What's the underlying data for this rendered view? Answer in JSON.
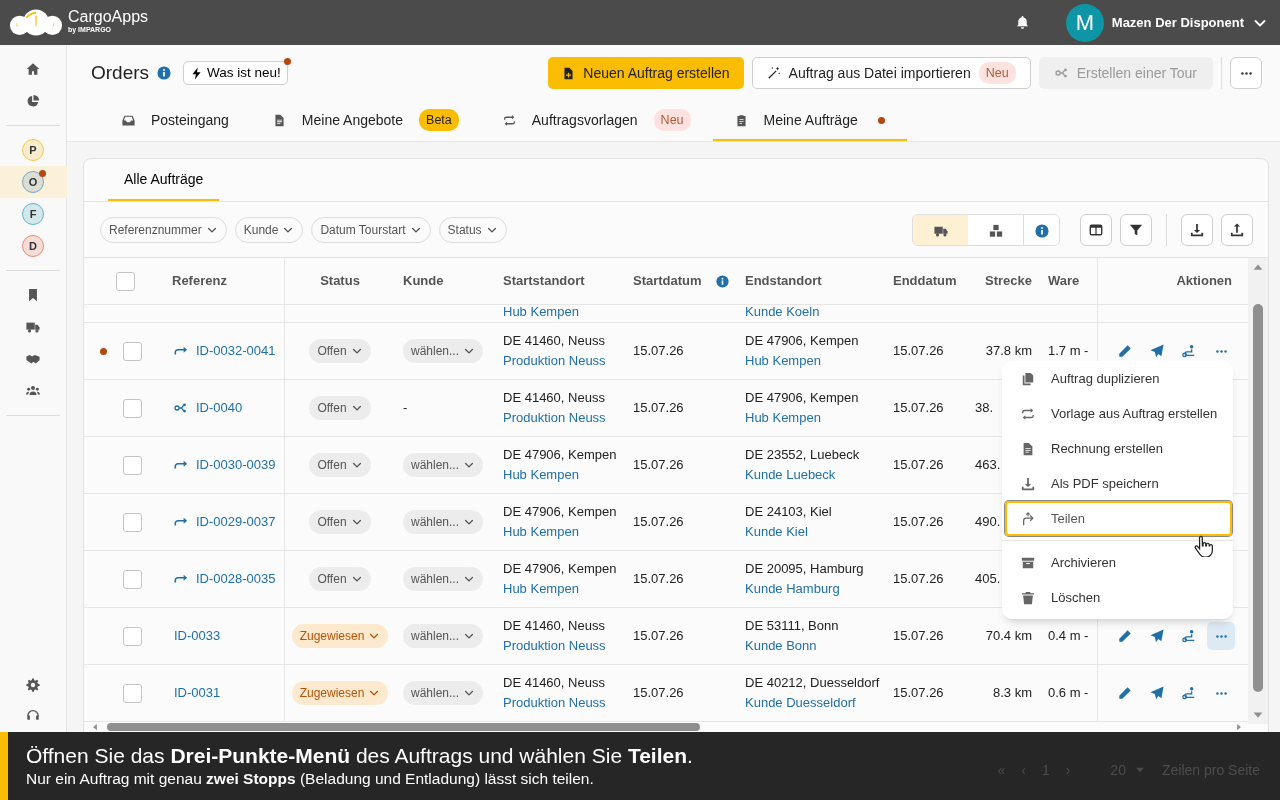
{
  "app": {
    "name": "CargoApps",
    "tagline": "by IMPARGO"
  },
  "user": {
    "initial": "M",
    "name": "Mazen Der Disponent"
  },
  "workspaces": [
    {
      "letter": "P",
      "color": "#f7c948",
      "selected": false,
      "unread": false
    },
    {
      "letter": "O",
      "color": "#7aa7c7",
      "selected": true,
      "unread": true
    },
    {
      "letter": "F",
      "color": "#5fb7c4",
      "selected": false,
      "unread": false
    },
    {
      "letter": "D",
      "color": "#e88b74",
      "selected": false,
      "unread": false
    }
  ],
  "page": {
    "title": "Orders",
    "whats_new": {
      "label": "Was ist neu!",
      "unread": true
    }
  },
  "actions": {
    "create": "Neuen Auftrag erstellen",
    "import": {
      "label": "Auftrag aus Datei importieren",
      "badge": "Neu"
    },
    "tour": {
      "label": "Erstellen einer Tour",
      "disabled": true
    }
  },
  "tabs": [
    {
      "label": "Posteingang",
      "selected": false
    },
    {
      "label": "Meine Angebote",
      "badge": {
        "label": "Beta",
        "kind": "beta"
      },
      "selected": false
    },
    {
      "label": "Auftragsvorlagen",
      "badge": {
        "label": "Neu",
        "kind": "new"
      },
      "selected": false
    },
    {
      "label": "Meine Aufträge",
      "unread": true,
      "selected": true
    }
  ],
  "subtabs": [
    {
      "label": "Alle Aufträge",
      "selected": true
    }
  ],
  "filters": [
    "Referenznummer",
    "Kunde",
    "Datum Tourstart",
    "Status"
  ],
  "view_modes": [
    {
      "selected": true
    },
    {
      "selected": false
    }
  ],
  "table": {
    "all_checked": false,
    "columns": [
      "Referenz",
      "Status",
      "Kunde",
      "Startstandort",
      "Startdatum",
      "Endstandort",
      "Enddatum",
      "Strecke",
      "Ware",
      "Aktionen"
    ],
    "partial_row": {
      "start_name": "Hub Kempen",
      "end_name": "Kunde Koeln"
    },
    "rows": [
      {
        "unread": true,
        "checked": false,
        "kind": "split",
        "reference": "ID-0032-0041",
        "status": {
          "label": "Offen",
          "kind": "open"
        },
        "customer": {
          "label": "wählen...",
          "kind": "select"
        },
        "start_city": "DE 41460, Neuss",
        "start_name": "Produktion Neuss",
        "start_date": "15.07.26",
        "end_city": "DE 47906, Kempen",
        "end_name": "Hub Kempen",
        "end_date": "15.07.26",
        "distance": "37.8 km",
        "goods": "1.7 m -",
        "menu_open": false
      },
      {
        "unread": false,
        "checked": false,
        "kind": "tour",
        "reference": "ID-0040",
        "status": {
          "label": "Offen",
          "kind": "open"
        },
        "customer": {
          "label": "-",
          "kind": "text"
        },
        "start_city": "DE 41460, Neuss",
        "start_name": "Produktion Neuss",
        "start_date": "15.07.26",
        "end_city": "DE 47906, Kempen",
        "end_name": "Hub Kempen",
        "end_date": "15.07.26",
        "distance": "38."
      },
      {
        "unread": false,
        "checked": false,
        "kind": "split",
        "reference": "ID-0030-0039",
        "status": {
          "label": "Offen",
          "kind": "open"
        },
        "customer": {
          "label": "wählen...",
          "kind": "select"
        },
        "start_city": "DE 47906, Kempen",
        "start_name": "Hub Kempen",
        "start_date": "15.07.26",
        "end_city": "DE 23552, Luebeck",
        "end_name": "Kunde Luebeck",
        "end_date": "15.07.26",
        "distance": "463."
      },
      {
        "unread": false,
        "checked": false,
        "kind": "split",
        "reference": "ID-0029-0037",
        "status": {
          "label": "Offen",
          "kind": "open"
        },
        "customer": {
          "label": "wählen...",
          "kind": "select"
        },
        "start_city": "DE 47906, Kempen",
        "start_name": "Hub Kempen",
        "start_date": "15.07.26",
        "end_city": "DE 24103, Kiel",
        "end_name": "Kunde Kiel",
        "end_date": "15.07.26",
        "distance": "490."
      },
      {
        "unread": false,
        "checked": false,
        "kind": "split",
        "reference": "ID-0028-0035",
        "status": {
          "label": "Offen",
          "kind": "open"
        },
        "customer": {
          "label": "wählen...",
          "kind": "select"
        },
        "start_city": "DE 47906, Kempen",
        "start_name": "Hub Kempen",
        "start_date": "15.07.26",
        "end_city": "DE 20095, Hamburg",
        "end_name": "Kunde Hamburg",
        "end_date": "15.07.26",
        "distance": "405."
      },
      {
        "unread": false,
        "checked": false,
        "kind": "plain",
        "reference": "ID-0033",
        "status": {
          "label": "Zugewiesen",
          "kind": "assigned"
        },
        "customer": {
          "label": "wählen...",
          "kind": "select"
        },
        "start_city": "DE 41460, Neuss",
        "start_name": "Produktion Neuss",
        "start_date": "15.07.26",
        "end_city": "DE 53111, Bonn",
        "end_name": "Kunde Bonn",
        "end_date": "15.07.26",
        "distance": "70.4 km",
        "goods": "0.4 m -",
        "menu_open": true
      },
      {
        "unread": false,
        "checked": false,
        "kind": "plain",
        "reference": "ID-0031",
        "status": {
          "label": "Zugewiesen",
          "kind": "assigned"
        },
        "customer": {
          "label": "wählen...",
          "kind": "select"
        },
        "start_city": "DE 41460, Neuss",
        "start_name": "Produktion Neuss",
        "start_date": "15.07.26",
        "end_city": "DE 40212, Duesseldorf",
        "end_name": "Kunde Duesseldorf",
        "end_date": "15.07.26",
        "distance": "8.3 km",
        "goods": "0.6 m -",
        "menu_open": false
      }
    ]
  },
  "menu": {
    "items": [
      {
        "label": "Auftrag duplizieren",
        "separator_before": false,
        "highlighted": false
      },
      {
        "label": "Vorlage aus Auftrag erstellen",
        "separator_before": false,
        "highlighted": false
      },
      {
        "label": "Rechnung erstellen",
        "separator_before": false,
        "highlighted": false
      },
      {
        "label": "Als PDF speichern",
        "separator_before": false,
        "highlighted": false
      },
      {
        "label": "Teilen",
        "separator_before": false,
        "highlighted": true
      },
      {
        "label": "Archivieren",
        "separator_before": true,
        "highlighted": false
      },
      {
        "label": "Löschen",
        "separator_before": false,
        "highlighted": false
      }
    ]
  },
  "pagination": {
    "first": "«",
    "prev": "‹",
    "page": "1",
    "next": "›",
    "rows_per_page": "20",
    "rows_label": "Zeilen pro Seite"
  },
  "caption": {
    "title": "Öffnen Sie das **Drei-Punkte-Menü** des Auftrags und wählen Sie **Teilen**.",
    "text": "Nur ein Auftrag mit genau **zwei Stopps** (Beladung und Entladung) lässt sich teilen."
  }
}
